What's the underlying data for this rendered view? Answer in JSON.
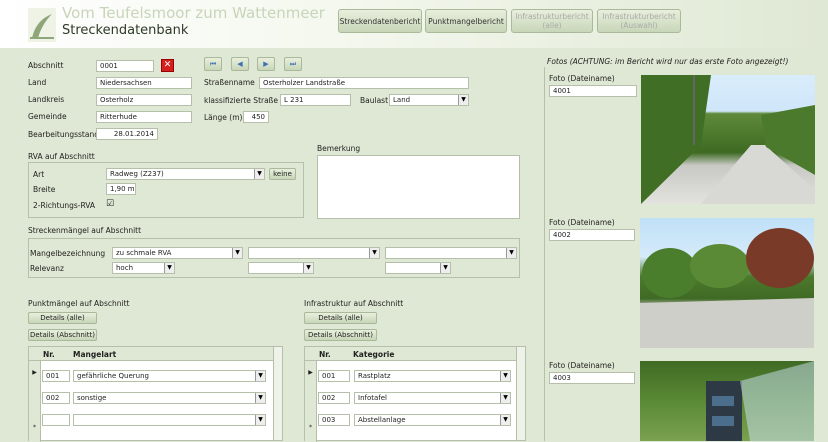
{
  "header": {
    "app_title": "Vom Teufelsmoor zum Wattenmeer",
    "subtitle": "Streckendatenbank",
    "buttons": [
      "Streckendatenbericht",
      "Punktmangelbericht",
      "Infrastrukturbericht\n(alle)",
      "Infrastrukturbericht\n(Auswahl)"
    ]
  },
  "nav": {
    "first": "⏮",
    "prev": "◀",
    "next": "▶",
    "last": "⏭"
  },
  "form": {
    "abschnitt_label": "Abschnitt",
    "abschnitt": "0001",
    "land_label": "Land",
    "land": "Niedersachsen",
    "landkreis_label": "Landkreis",
    "landkreis": "Osterholz",
    "gemeinde_label": "Gemeinde",
    "gemeinde": "Ritterhude",
    "bearb_label": "Bearbeitungsstand",
    "bearb": "28.01.2014",
    "strasse_label": "Straßenname",
    "strasse": "Osterholzer Landstraße",
    "klass_label": "klassifizierte Straße",
    "klass": "L 231",
    "baulast_label": "Baulast",
    "baulast": "Land",
    "laenge_label": "Länge (m)",
    "laenge": "450"
  },
  "rva": {
    "title": "RVA auf Abschnitt",
    "art_label": "Art",
    "art": "Radweg (Z237)",
    "keine": "keine",
    "breite_label": "Breite",
    "breite": "1,90 m",
    "zwei_label": "2-Richtungs-RVA",
    "zwei": "☑"
  },
  "bemerkung": {
    "label": "Bemerkung"
  },
  "strecken": {
    "title": "Streckenmängel auf Abschnitt",
    "mangel_label": "Mangelbezeichnung",
    "mangel1": "zu schmale RVA",
    "relevanz_label": "Relevanz",
    "relevanz1": "hoch"
  },
  "punkt": {
    "title": "Punktmängel auf Abschnitt",
    "btn1": "Details (alle)",
    "btn2": "Details (Abschnitt)",
    "col_nr": "Nr.",
    "col_art": "Mangelart",
    "rows": [
      {
        "nr": "001",
        "val": "gefährliche Querung"
      },
      {
        "nr": "002",
        "val": "sonstige"
      }
    ]
  },
  "infra": {
    "title": "Infrastruktur auf Abschnitt",
    "btn1": "Details (alle)",
    "btn2": "Details (Abschnitt)",
    "col_nr": "Nr.",
    "col_kat": "Kategorie",
    "rows": [
      {
        "nr": "001",
        "val": "Rastplatz"
      },
      {
        "nr": "002",
        "val": "Infotafel"
      },
      {
        "nr": "003",
        "val": "Abstellanlage"
      }
    ]
  },
  "fotos": {
    "title": "Fotos (ACHTUNG: im Bericht wird nur das erste Foto angezeigt!)",
    "label": "Foto (Dateiname)",
    "items": [
      "4001",
      "4002",
      "4003"
    ]
  },
  "colors": {
    "bg": "#dfe8d4",
    "accent": "#3a6fb3",
    "delete": "#d62020"
  }
}
